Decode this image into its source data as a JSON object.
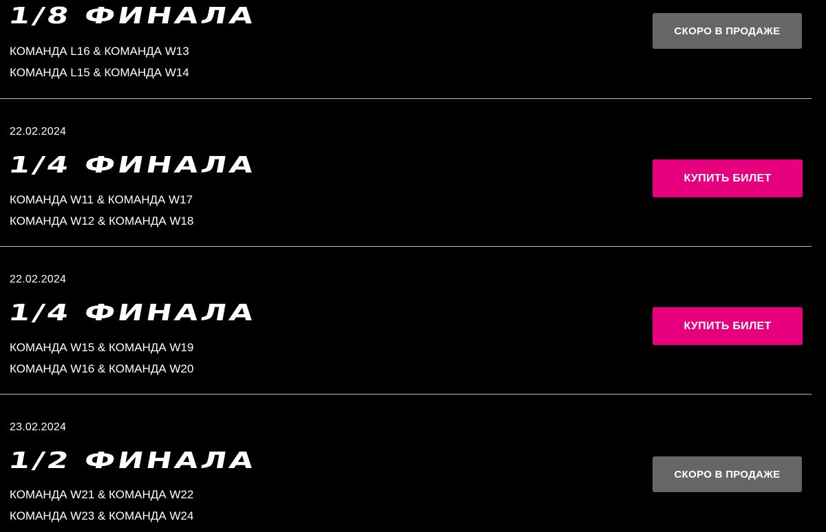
{
  "colors": {
    "background": "#000000",
    "text": "#ffffff",
    "divider": "#bdbdbd",
    "buy_button": "#e6007e",
    "soon_button": "#666666"
  },
  "matches": [
    {
      "date": "",
      "stage": "1/8 ФИНАЛА",
      "pairs": [
        "КОМАНДА L16 & КОМАНДА W13",
        "КОМАНДА L15 & КОМАНДА W14"
      ],
      "button_label": "СКОРО В ПРОДАЖЕ",
      "button_state": "soon"
    },
    {
      "date": "22.02.2024",
      "stage": "1/4 ФИНАЛА",
      "pairs": [
        "КОМАНДА W11 & КОМАНДА W17",
        "КОМАНДА W12 & КОМАНДА W18"
      ],
      "button_label": "КУПИТЬ БИЛЕТ",
      "button_state": "buy"
    },
    {
      "date": "22.02.2024",
      "stage": "1/4 ФИНАЛА",
      "pairs": [
        "КОМАНДА W15 & КОМАНДА W19",
        "КОМАНДА W16 & КОМАНДА W20"
      ],
      "button_label": "КУПИТЬ БИЛЕТ",
      "button_state": "buy"
    },
    {
      "date": "23.02.2024",
      "stage": "1/2 ФИНАЛА",
      "pairs": [
        "КОМАНДА W21 & КОМАНДА W22",
        "КОМАНДА W23 & КОМАНДА W24"
      ],
      "button_label": "СКОРО В ПРОДАЖЕ",
      "button_state": "soon"
    }
  ]
}
